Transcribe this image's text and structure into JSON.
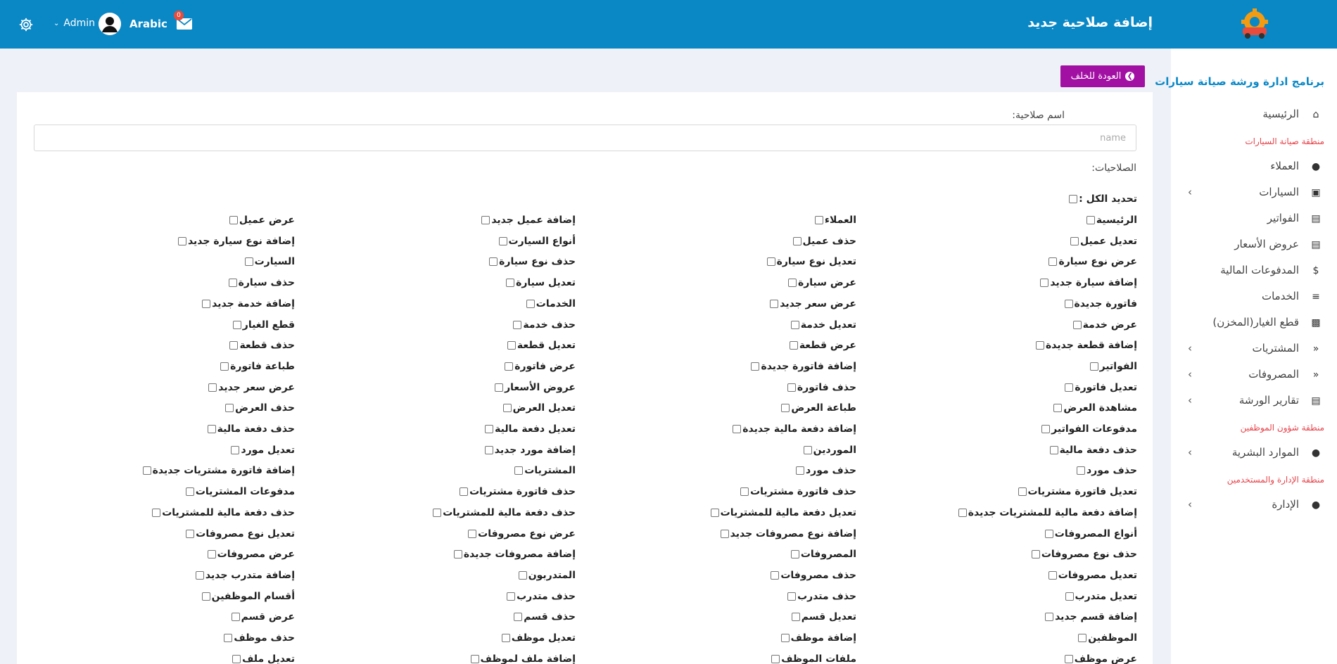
{
  "header": {
    "page_title": "إضافة صلاحية جديد",
    "language": "Arabic",
    "user": "Admin",
    "mail_count": "0"
  },
  "sidebar": {
    "brand": "برنامج ادارة ورشة صيانة سيارات",
    "items": [
      {
        "label": "الرئيسية",
        "icon": "home-icon",
        "chevron": false
      },
      {
        "section": "منطقة صيانة السيارات"
      },
      {
        "label": "العملاء",
        "icon": "user-icon",
        "chevron": false
      },
      {
        "label": "السيارات",
        "icon": "car-icon",
        "chevron": true
      },
      {
        "label": "الفواتير",
        "icon": "file-invoice-icon",
        "chevron": false
      },
      {
        "label": "عروض الأسعار",
        "icon": "file-icon",
        "chevron": false
      },
      {
        "label": "المدفوعات المالية",
        "icon": "dollar-icon",
        "chevron": false
      },
      {
        "label": "الخدمات",
        "icon": "list-icon",
        "chevron": false
      },
      {
        "label": "قطع الغيار(المخزن)",
        "icon": "robot-icon",
        "chevron": false
      },
      {
        "label": "المشتريات",
        "icon": "angles-left-icon",
        "chevron": true
      },
      {
        "label": "المصروفات",
        "icon": "angles-left-icon",
        "chevron": true
      },
      {
        "label": "تقارير الورشة",
        "icon": "chart-icon",
        "chevron": true
      },
      {
        "section": "منطقة شؤون الموظفين"
      },
      {
        "label": "الموارد البشرية",
        "icon": "user-tie-icon",
        "chevron": true
      },
      {
        "section": "منطقة الإدارة والمستخدمين"
      },
      {
        "label": "الإدارة",
        "icon": "user-gear-icon",
        "chevron": true
      }
    ],
    "section_color": "#e8434a",
    "brand_color": "#0a88c6"
  },
  "back_button": {
    "label": "العودة للخلف",
    "color": "#a20fa3"
  },
  "form": {
    "name_label": "اسم صلاحية:",
    "name_placeholder": "name",
    "permissions_label": "الصلاحيات:",
    "select_all": "تحديد الكل :",
    "permissions": [
      [
        "الرئيسية",
        "العملاء",
        "إضافة عميل جديد",
        "عرض عميل"
      ],
      [
        "تعديل عميل",
        "حذف عميل",
        "أنواع السيارت",
        "إضافة نوع سيارة جديد"
      ],
      [
        "عرض نوع سيارة",
        "تعديل نوع سيارة",
        "حذف نوع سيارة",
        "السيارت"
      ],
      [
        "إضافة سيارة جديد",
        "عرض سيارة",
        "تعديل سيارة",
        "حذف سيارة"
      ],
      [
        "فاتورة جديدة",
        "عرض سعر جديد",
        "الخدمات",
        "إضافة خدمة جديد"
      ],
      [
        "عرض خدمة",
        "تعديل خدمة",
        "حذف خدمة",
        "قطع الغيار"
      ],
      [
        "إضافة قطعة جديدة",
        "عرض قطعة",
        "تعديل قطعة",
        "حذف قطعة"
      ],
      [
        "الفواتير",
        "إضافة فاتورة جديدة",
        "عرض فاتورة",
        "طباعة فاتورة"
      ],
      [
        "تعديل فاتورة",
        "حذف فاتورة",
        "عروض الأسعار",
        "عرض سعر جديد"
      ],
      [
        "مشاهدة العرض",
        "طباعة العرض",
        "تعديل العرض",
        "حذف العرض"
      ],
      [
        "مدفوعات الفواتير",
        "إضافة دفعة مالية جديدة",
        "تعديل دفعة مالية",
        "حذف دفعة مالية"
      ],
      [
        "حذف دفعة مالية",
        "الموردين",
        "إضافة مورد جديد",
        "تعديل مورد"
      ],
      [
        "حذف مورد",
        "حذف مورد",
        "المشتريات",
        "إضافة فاتورة مشتريات جديدة"
      ],
      [
        "تعديل فاتورة مشتريات",
        "حذف فاتورة مشتريات",
        "حذف فاتورة مشتريات",
        "مدفوعات المشتريات"
      ],
      [
        "إضافة دفعة مالية للمشتريات جديدة",
        "تعديل دفعة مالية للمشتريات",
        "حذف دفعة مالية للمشتريات",
        "حذف دفعة مالية للمشتريات"
      ],
      [
        "أنواع المصروفات",
        "إضافة نوع مصروفات جديد",
        "عرض نوع مصروفات",
        "تعديل نوع مصروفات"
      ],
      [
        "حذف نوع مصروفات",
        "المصروفات",
        "إضافة مصروفات جديدة",
        "عرض مصروفات"
      ],
      [
        "تعديل مصروفات",
        "حذف مصروفات",
        "المتدربون",
        "إضافة متدرب جديد"
      ],
      [
        "تعديل متدرب",
        "حذف متدرب",
        "حذف متدرب",
        "أقسام الموظفين"
      ],
      [
        "إضافة قسم جديد",
        "تعديل قسم",
        "حذف قسم",
        "عرض قسم"
      ],
      [
        "الموظفين",
        "إضافة موظف",
        "تعديل موظف",
        "حذف موظف"
      ],
      [
        "عرض موظف",
        "ملفات الموظف",
        "إضافة ملف لموظف",
        "تعديل ملف"
      ]
    ]
  }
}
